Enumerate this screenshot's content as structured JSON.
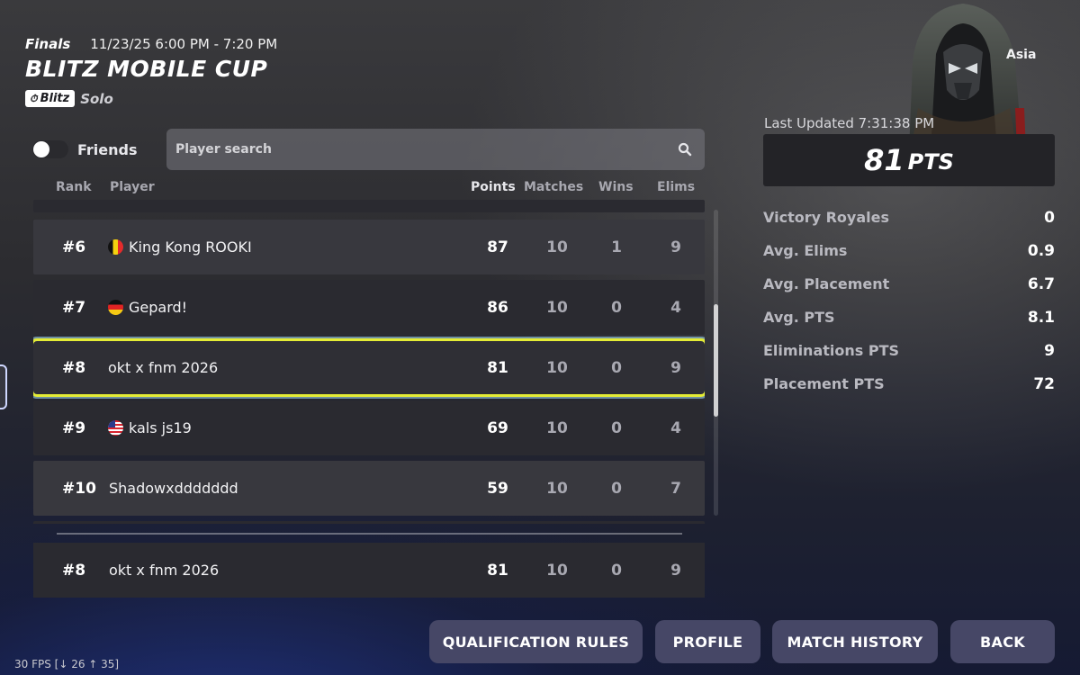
{
  "header": {
    "phase": "Finals",
    "time_range": "11/23/25 6:00 PM - 7:20 PM",
    "title": "BLITZ MOBILE CUP",
    "badge": "Blitz",
    "mode": "Solo"
  },
  "controls": {
    "friends_label": "Friends",
    "friends_enabled": false,
    "search_placeholder": "Player search"
  },
  "table": {
    "columns": [
      "Rank",
      "Player",
      "Points",
      "Matches",
      "Wins",
      "Elims"
    ],
    "rows": [
      {
        "rank": "#6",
        "flag": "belgium-flag",
        "player": "King Kong ROOKI",
        "points": "87",
        "matches": "10",
        "wins": "1",
        "elims": "9"
      },
      {
        "rank": "#7",
        "flag": "germany-flag",
        "player": "Gepard!",
        "points": "86",
        "matches": "10",
        "wins": "0",
        "elims": "4"
      },
      {
        "rank": "#8",
        "flag": "",
        "player": "okt x fnm 2026",
        "points": "81",
        "matches": "10",
        "wins": "0",
        "elims": "9",
        "highlighted": true
      },
      {
        "rank": "#9",
        "flag": "usa-flag",
        "player": "kals js19",
        "points": "69",
        "matches": "10",
        "wins": "0",
        "elims": "4"
      },
      {
        "rank": "#10",
        "flag": "",
        "player": "Shadowxddddddd",
        "points": "59",
        "matches": "10",
        "wins": "0",
        "elims": "7"
      }
    ],
    "self_row": {
      "rank": "#8",
      "player": "okt x fnm 2026",
      "points": "81",
      "matches": "10",
      "wins": "0",
      "elims": "9"
    }
  },
  "profile": {
    "region": "Asia",
    "last_updated": "Last Updated 7:31:38 PM",
    "points_value": "81",
    "points_unit": "PTS",
    "stats": [
      {
        "label": "Victory Royales",
        "value": "0"
      },
      {
        "label": "Avg. Elims",
        "value": "0.9"
      },
      {
        "label": "Avg. Placement",
        "value": "6.7"
      },
      {
        "label": "Avg. PTS",
        "value": "8.1"
      },
      {
        "label": "Eliminations PTS",
        "value": "9"
      },
      {
        "label": "Placement PTS",
        "value": "72"
      }
    ]
  },
  "buttons": {
    "qualification_rules": "QUALIFICATION RULES",
    "profile": "PROFILE",
    "match_history": "MATCH HISTORY",
    "back": "BACK"
  },
  "fps": "30 FPS [↓ 26 ↑ 35]",
  "colors": {
    "highlight_outline": "#e4ec35",
    "button_bg": "#464766"
  }
}
